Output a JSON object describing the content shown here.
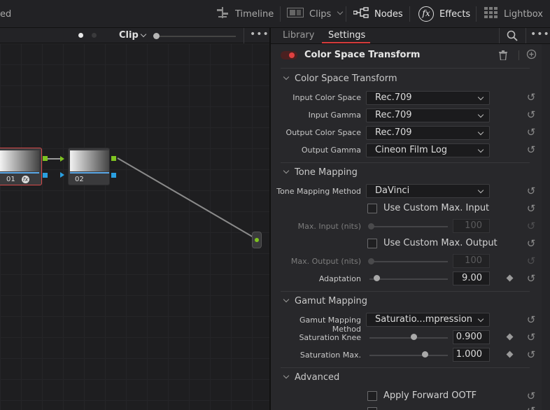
{
  "topbar": {
    "left_fragment": "ed",
    "timeline": "Timeline",
    "clips": "Clips",
    "nodes": "Nodes",
    "effects": "Effects",
    "lightbox": "Lightbox"
  },
  "node_editor": {
    "mode_label": "Clip",
    "nodes": [
      {
        "id": "01",
        "label": "01"
      },
      {
        "id": "02",
        "label": "02"
      }
    ]
  },
  "panel": {
    "tabs": [
      "Library",
      "Settings"
    ],
    "active_tab": "Settings",
    "effect_title": "Color Space Transform",
    "sections": {
      "cst": "Color Space Transform",
      "tone": "Tone Mapping",
      "gamut": "Gamut Mapping",
      "advanced": "Advanced"
    },
    "fields": {
      "input_color_space": {
        "label": "Input Color Space",
        "value": "Rec.709"
      },
      "input_gamma": {
        "label": "Input Gamma",
        "value": "Rec.709"
      },
      "output_color_space": {
        "label": "Output Color Space",
        "value": "Rec.709"
      },
      "output_gamma": {
        "label": "Output Gamma",
        "value": "Cineon Film Log"
      },
      "tone_mapping_method": {
        "label": "Tone Mapping Method",
        "value": "DaVinci"
      },
      "use_custom_max_input": {
        "label": "Use Custom Max. Input",
        "checked": false
      },
      "max_input": {
        "label": "Max. Input (nits)",
        "value": "100"
      },
      "use_custom_max_output": {
        "label": "Use Custom Max. Output",
        "checked": false
      },
      "max_output": {
        "label": "Max. Output (nits)",
        "value": "100"
      },
      "adaptation": {
        "label": "Adaptation",
        "value": "9.00"
      },
      "gamut_mapping_method": {
        "label": "Gamut Mapping Method",
        "value": "Saturatio...mpression"
      },
      "saturation_knee": {
        "label": "Saturation Knee",
        "value": "0.900"
      },
      "saturation_max": {
        "label": "Saturation Max.",
        "value": "1.000"
      },
      "apply_forward_ootf": {
        "label": "Apply Forward OOTF",
        "checked": false
      }
    }
  },
  "colors": {
    "accent_red": "#e04040",
    "node_output_green": "#7ec320",
    "node_input_blue": "#2a9fe0",
    "tab_underline": "#d63c3c"
  }
}
